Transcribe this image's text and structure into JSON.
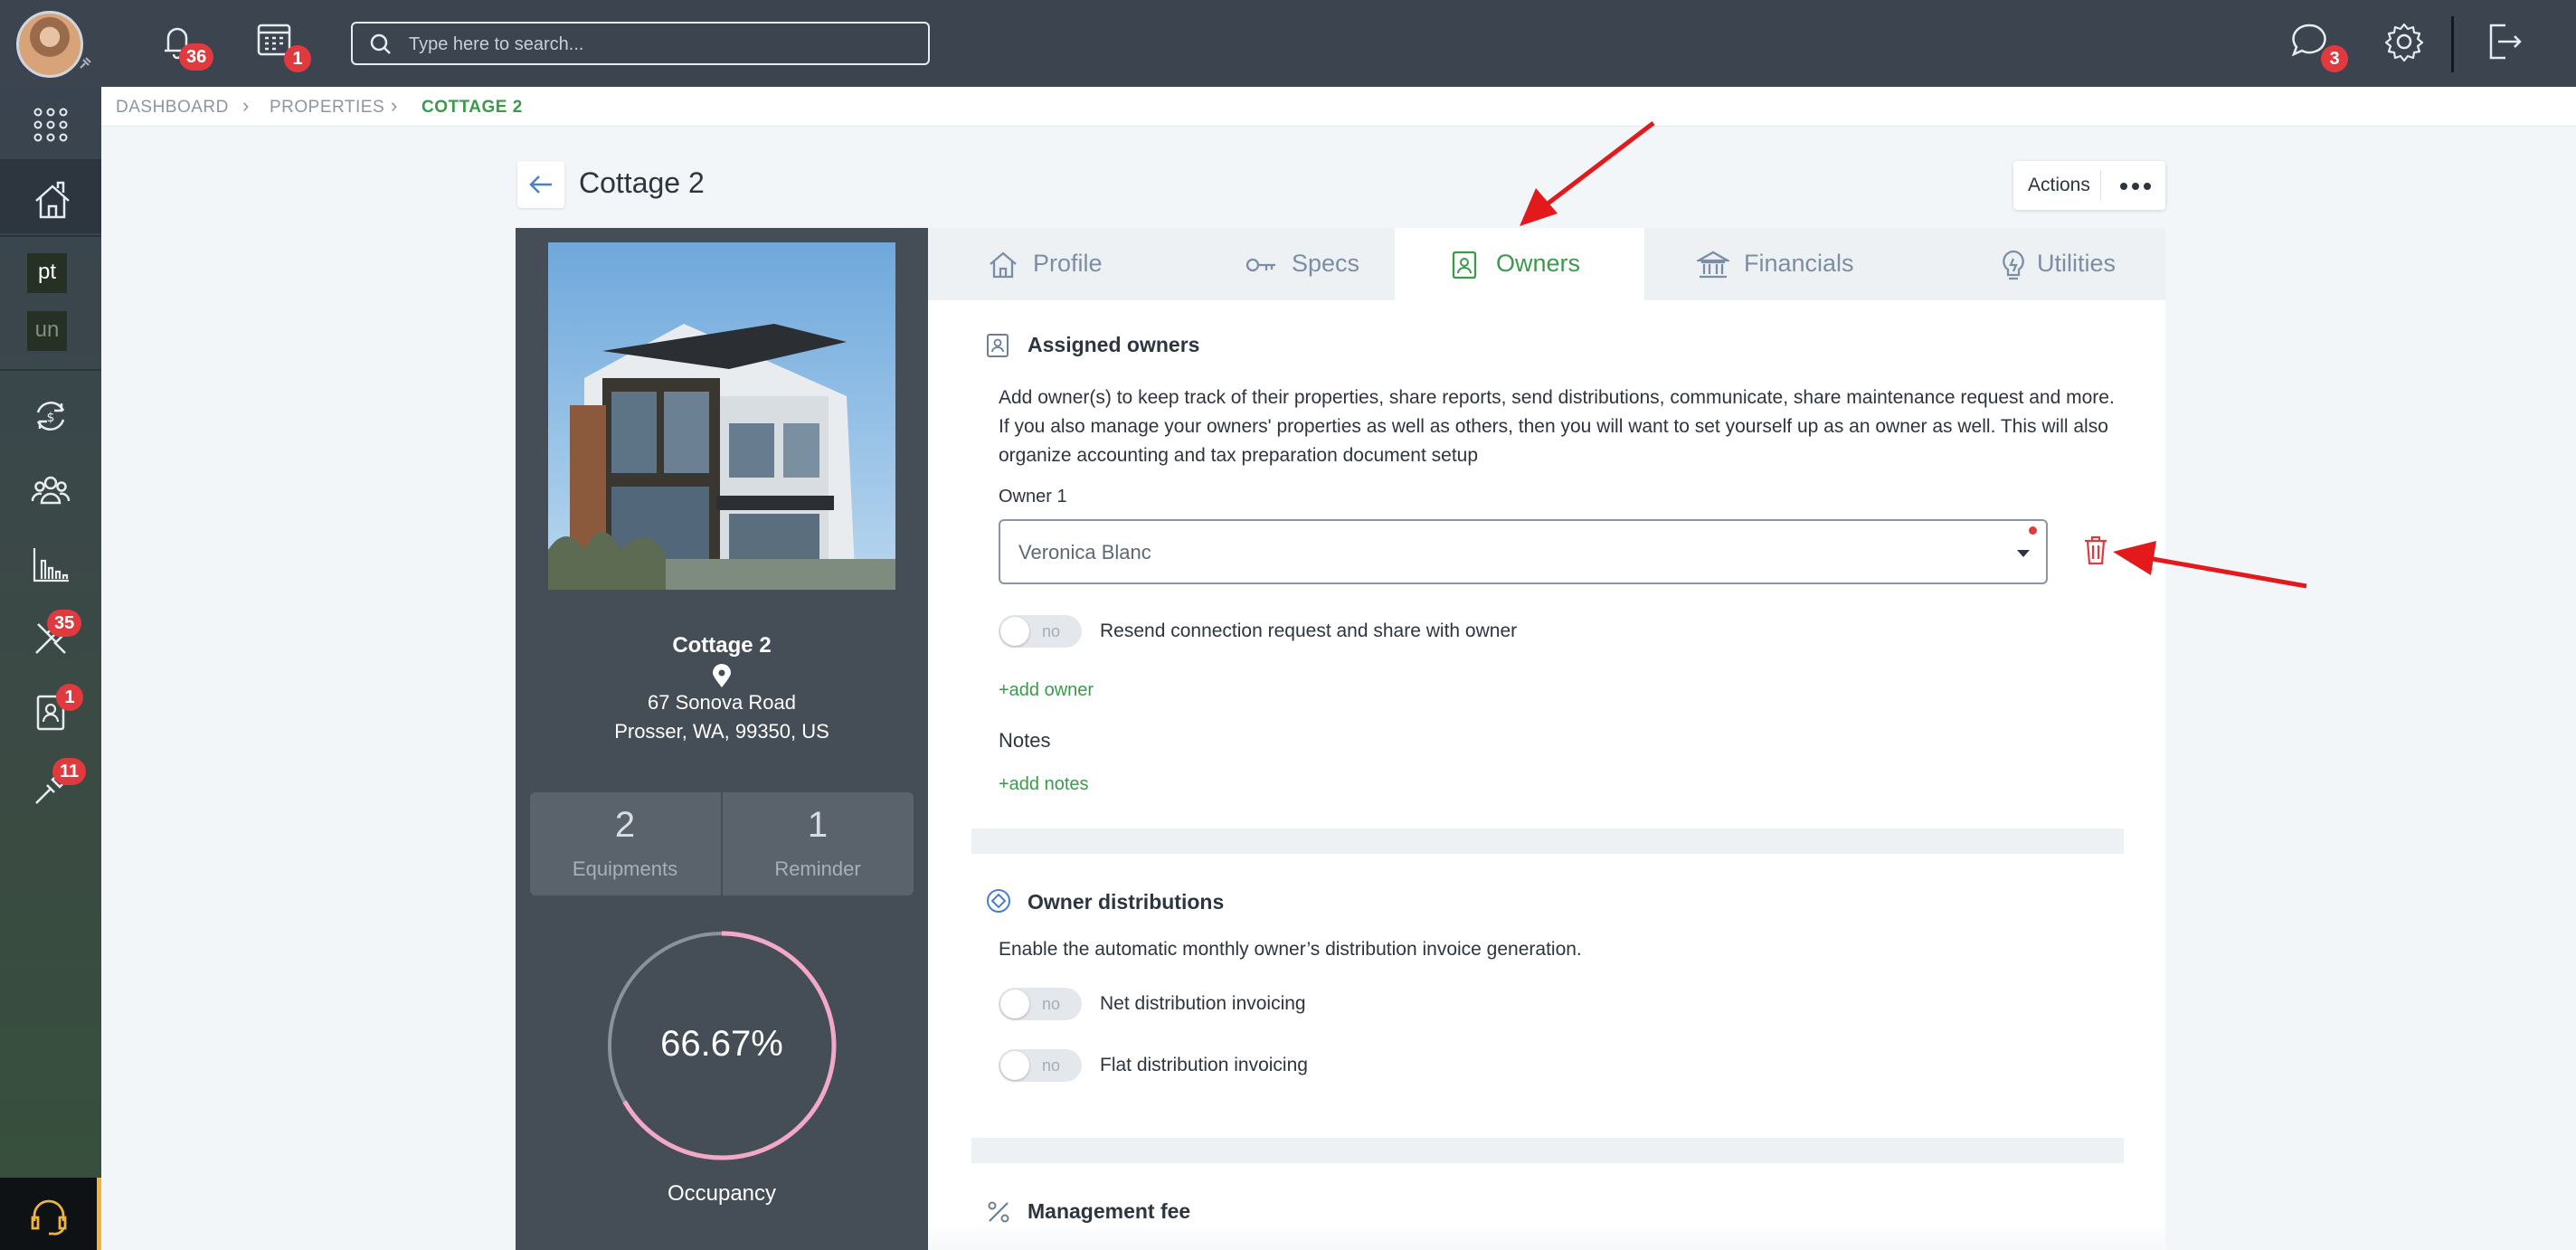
{
  "topbar": {
    "notifications_count": "36",
    "calendar_count": "1",
    "search_placeholder": "Type here to search...",
    "messages_count": "3"
  },
  "sidenav": {
    "text_items": [
      "pt",
      "un"
    ],
    "maintenance_count": "35",
    "contacts_count": "1",
    "tools_count": "11"
  },
  "breadcrumb": [
    "DASHBOARD",
    "PROPERTIES",
    "COTTAGE 2"
  ],
  "page": {
    "title": "Cottage 2",
    "actions_label": "Actions"
  },
  "property": {
    "name": "Cottage 2",
    "address_line1": "67 Sonova Road",
    "address_line2": "Prosser, WA, 99350, US",
    "stats": [
      {
        "value": "2",
        "label": "Equipments"
      },
      {
        "value": "1",
        "label": "Reminder"
      }
    ],
    "occupancy_value": "66.67%",
    "occupancy_fraction": 0.6667,
    "occupancy_label": "Occupancy"
  },
  "tabs": [
    {
      "label": "Profile",
      "icon": "house-icon",
      "active": false
    },
    {
      "label": "Specs",
      "icon": "key-icon",
      "active": false
    },
    {
      "label": "Owners",
      "icon": "owner-badge-icon",
      "active": true
    },
    {
      "label": "Financials",
      "icon": "bank-icon",
      "active": false
    },
    {
      "label": "Utilities",
      "icon": "lightbulb-icon",
      "active": false
    }
  ],
  "owners": {
    "section_title": "Assigned owners",
    "description": "Add owner(s) to keep track of their properties, share reports, send distributions, communicate, share maintenance request and more. If you also manage your owners' properties as well as others, then you will want to set yourself up as an owner as well. This will also organize accounting and tax preparation document setup",
    "owner1_label": "Owner 1",
    "owner1_value": "Veronica Blanc",
    "resend_toggle": "no",
    "resend_label": "Resend connection request and share with owner",
    "add_owner": "+add owner",
    "notes_label": "Notes",
    "add_notes": "+add notes"
  },
  "distributions": {
    "section_title": "Owner distributions",
    "description": "Enable the automatic monthly owner’s distribution invoice generation.",
    "net_toggle": "no",
    "net_label": "Net distribution invoicing",
    "flat_toggle": "no",
    "flat_label": "Flat distribution invoicing"
  },
  "management": {
    "section_title": "Management fee"
  },
  "colors": {
    "accent_green": "#3a9a4a",
    "badge_red": "#e03a3e",
    "topbar": "#3b444f",
    "gauge_pink": "#f4a8c8",
    "arrow_red": "#e3191c"
  }
}
